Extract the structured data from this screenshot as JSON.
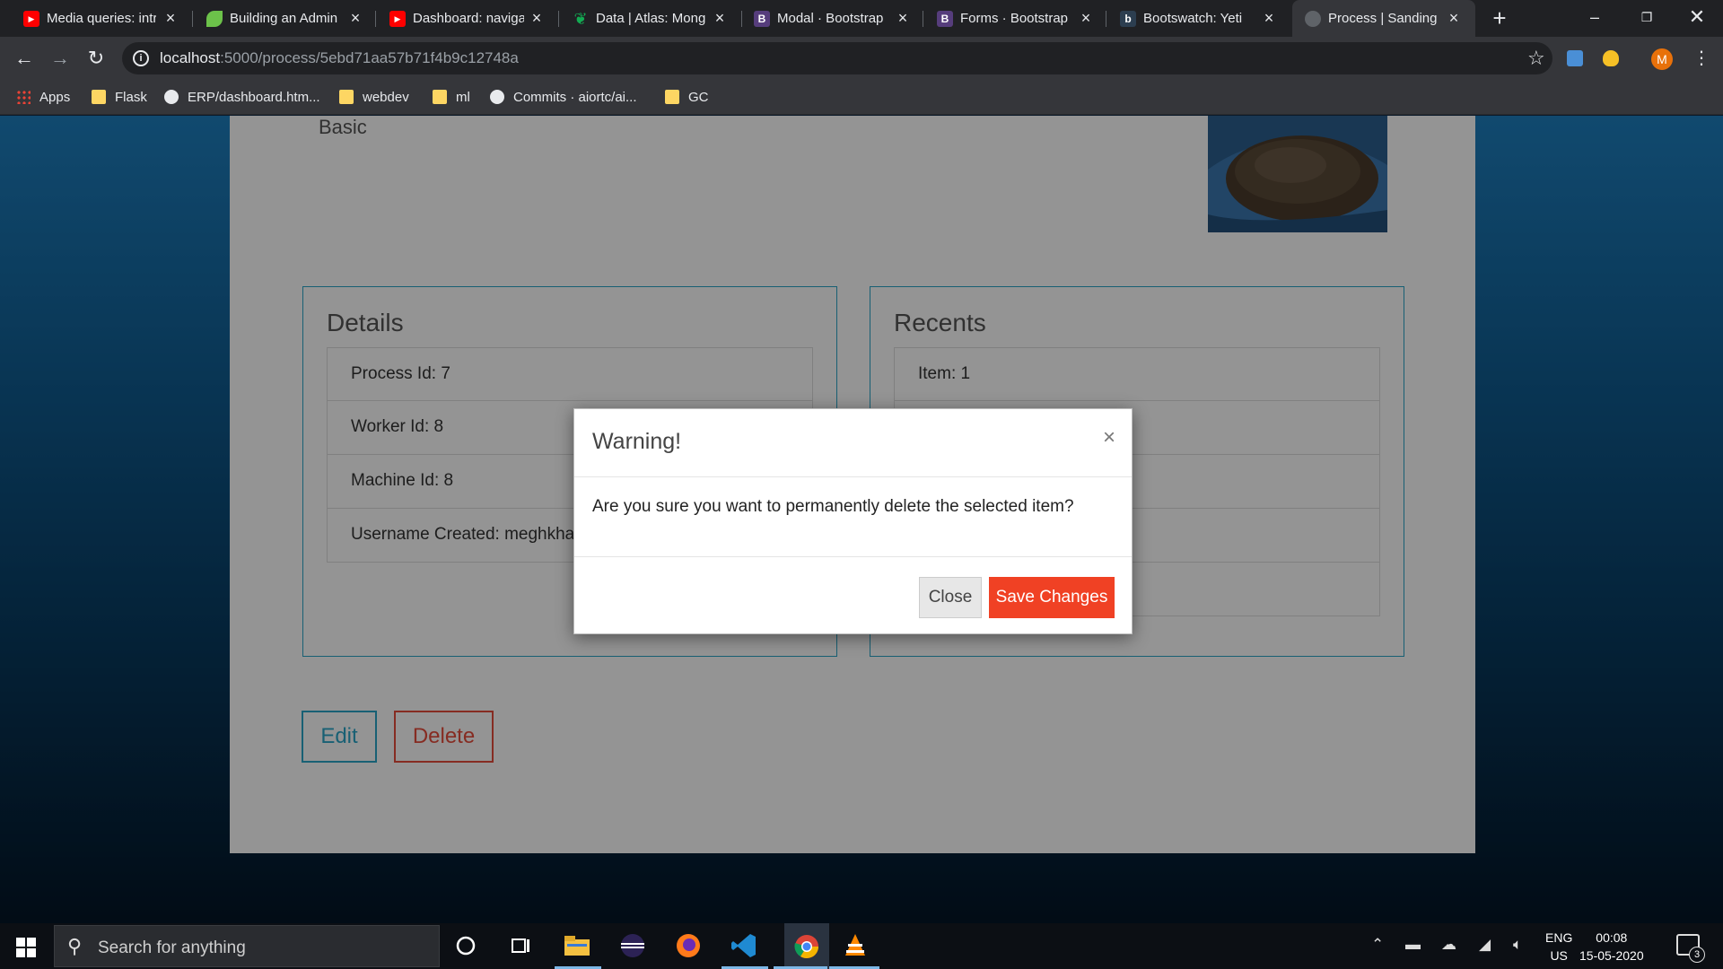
{
  "browser": {
    "tabs": [
      {
        "label": "Media queries: intr",
        "icon": "youtube-icon",
        "color": "#ff0000"
      },
      {
        "label": "Building an Admin",
        "icon": "leaf-icon",
        "color": "#34a853"
      },
      {
        "label": "Dashboard: naviga",
        "icon": "youtube-icon",
        "color": "#ff0000"
      },
      {
        "label": "Data | Atlas: Mong",
        "icon": "mongodb-leaf-icon",
        "color": "#13aa52"
      },
      {
        "label": "Modal · Bootstrap",
        "icon": "bootstrap-icon",
        "color": "#563d7c"
      },
      {
        "label": "Forms · Bootstrap",
        "icon": "bootstrap-icon",
        "color": "#563d7c"
      },
      {
        "label": "Bootswatch: Yeti",
        "icon": "bootswatch-icon",
        "color": "#2c3e50"
      },
      {
        "label": "Process | Sanding",
        "icon": "globe-icon",
        "color": "#5f6368"
      }
    ],
    "url": {
      "host": "localhost",
      "rest": ":5000/process/5ebd71aa57b71f4b9c12748a"
    },
    "avatar_letter": "M",
    "bookmarks": [
      {
        "label": "Apps",
        "icon": "apps-grid-icon"
      },
      {
        "label": "Flask",
        "icon": "folder-icon"
      },
      {
        "label": "ERP/dashboard.htm...",
        "icon": "github-icon"
      },
      {
        "label": "webdev",
        "icon": "folder-icon"
      },
      {
        "label": "ml",
        "icon": "folder-icon"
      },
      {
        "label": "Commits · aiortc/ai...",
        "icon": "github-icon"
      },
      {
        "label": "GC",
        "icon": "folder-icon"
      }
    ]
  },
  "page": {
    "section_label": "Basic",
    "details": {
      "title": "Details",
      "items": [
        "Process Id: 7",
        "Worker Id: 8",
        "Machine Id: 8",
        "Username Created: meghkha"
      ]
    },
    "recents": {
      "title": "Recents",
      "items": [
        "Item: 1",
        "",
        "",
        "",
        ""
      ]
    },
    "edit_label": "Edit",
    "delete_label": "Delete"
  },
  "modal": {
    "title": "Warning!",
    "close_glyph": "×",
    "body": "Are you sure you want to permanently delete the selected item?",
    "close_label": "Close",
    "save_label": "Save Changes"
  },
  "taskbar": {
    "search_placeholder": "Search for anything",
    "lang_top": "ENG",
    "lang_bottom": "US",
    "time": "00:08",
    "date": "15-05-2020",
    "notification_count": "3"
  },
  "colors": {
    "accent": "#2aa5c8",
    "danger": "#f04124"
  }
}
